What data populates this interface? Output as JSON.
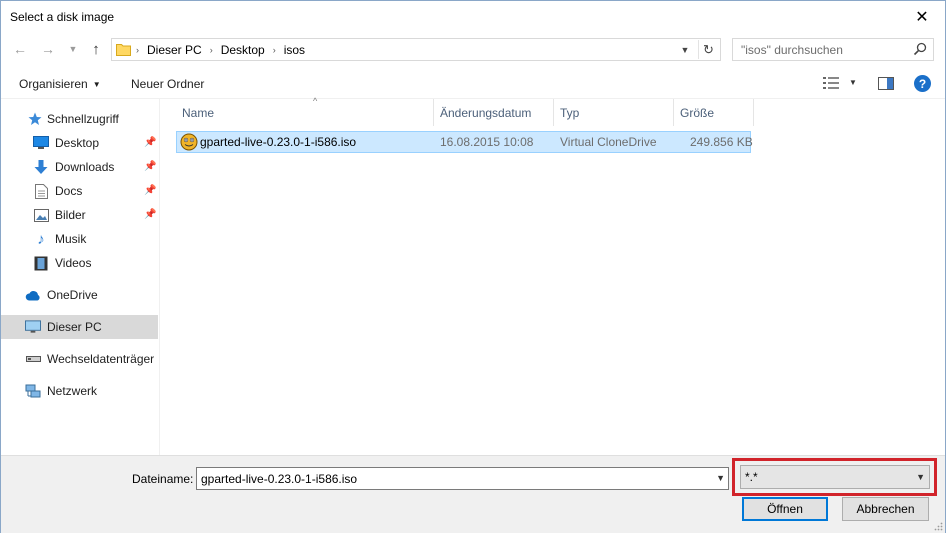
{
  "window": {
    "title": "Select a disk image"
  },
  "address": {
    "crumbs": [
      "Dieser PC",
      "Desktop",
      "isos"
    ],
    "search_placeholder": "\"isos\" durchsuchen"
  },
  "toolbar": {
    "organize": "Organisieren",
    "new_folder": "Neuer Ordner"
  },
  "nav": {
    "quick_access": "Schnellzugriff",
    "items": [
      "Desktop",
      "Downloads",
      "Docs",
      "Bilder",
      "Musik",
      "Videos"
    ],
    "onedrive": "OneDrive",
    "this_pc": "Dieser PC",
    "removable": "Wechseldatenträger (",
    "network": "Netzwerk"
  },
  "columns": {
    "name": "Name",
    "date": "Änderungsdatum",
    "type": "Typ",
    "size": "Größe"
  },
  "files": [
    {
      "name": "gparted-live-0.23.0-1-i586.iso",
      "date": "16.08.2015 10:08",
      "type": "Virtual CloneDrive",
      "size": "249.856 KB"
    }
  ],
  "bottom": {
    "filename_label": "Dateiname:",
    "filename_value": "gparted-live-0.23.0-1-i586.iso",
    "filetype_value": "*.*",
    "open_label": "Öffnen",
    "cancel_label": "Abbrechen"
  },
  "colors": {
    "selection": "#cce8ff",
    "highlight_box": "#d1232a",
    "accent": "#0078d7"
  }
}
